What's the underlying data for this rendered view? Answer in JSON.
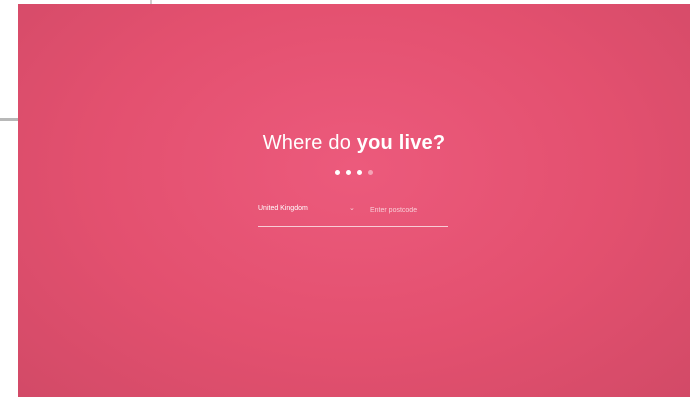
{
  "screen": {
    "background_color": "#e4526f",
    "question_prefix": "Where do",
    "question_emphasis": "you live?"
  },
  "progress": {
    "current_step": 3,
    "total_steps": 4
  },
  "form": {
    "country_value": "United Kingdom",
    "postcode_placeholder": "Enter postcode",
    "postcode_value": ""
  }
}
